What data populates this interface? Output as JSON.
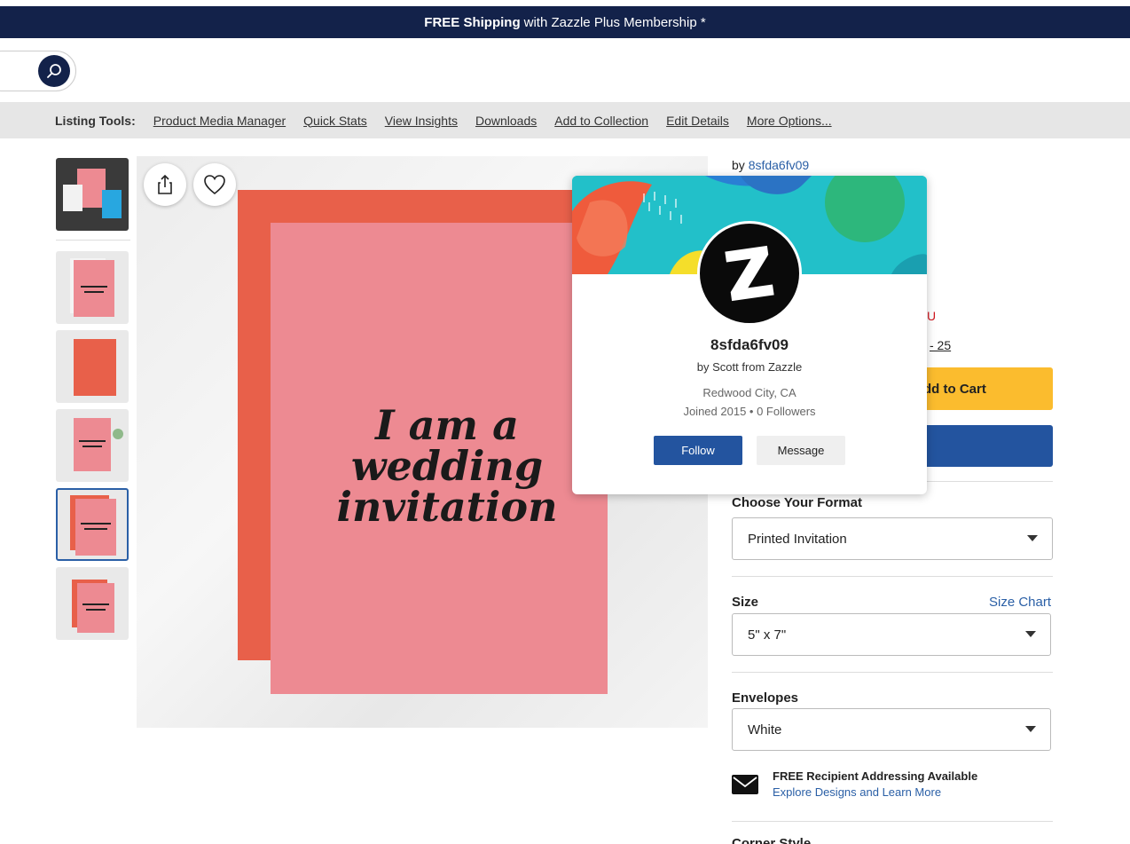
{
  "promo_banner": {
    "bold": "FREE Shipping",
    "rest": "with Zazzle Plus Membership *"
  },
  "listing_tools": {
    "label": "Listing Tools:",
    "links": [
      "Product Media Manager",
      "Quick Stats",
      "View Insights",
      "Downloads",
      "Add to Collection",
      "Edit Details",
      "More Options..."
    ]
  },
  "product_image": {
    "text_line1": "I am a wedding",
    "text_line2": "invitation"
  },
  "thumbnails": {
    "count": 6,
    "selected_index": 4
  },
  "product": {
    "by_prefix": "by",
    "by_store": "8sfda6fv09",
    "red_fragment": "U",
    "link_fragment": "- 25",
    "add_to_cart": "dd to Cart"
  },
  "options": {
    "format_label": "Choose Your Format",
    "format_value": "Printed Invitation",
    "size_label": "Size",
    "size_chart": "Size Chart",
    "size_value": "5\" x 7\"",
    "envelopes_label": "Envelopes",
    "envelopes_value": "White",
    "addressing_title": "FREE Recipient Addressing Available",
    "addressing_link": "Explore Designs and Learn More",
    "next_label": "Corner Style"
  },
  "store_popover": {
    "name": "8sfda6fv09",
    "by": "by Scott from Zazzle",
    "location": "Redwood City, CA",
    "joined": "Joined 2015 • 0 Followers",
    "follow": "Follow",
    "message": "Message"
  },
  "colors": {
    "navy": "#13224a",
    "blue": "#23549f",
    "yellow": "#fbbc2e",
    "link": "#2a5fa6"
  }
}
